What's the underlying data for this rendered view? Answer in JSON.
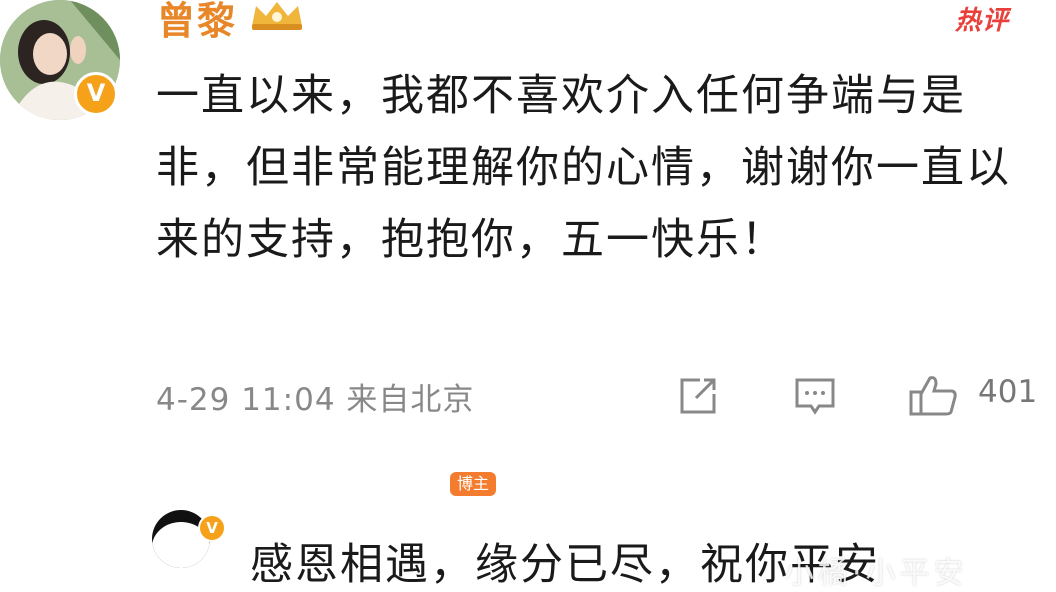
{
  "comment": {
    "username": "曾黎",
    "verified_mark": "V",
    "hot_label": "热评",
    "text": "一直以来，我都不喜欢介入任何争端与是非，但非常能理解你的心情，谢谢你一直以来的支持，抱抱你，五一快乐！",
    "timestamp": "4-29 11:04",
    "location": "来自北京",
    "like_count": "401",
    "icons": {
      "share": "share-icon",
      "comment": "comment-icon",
      "like": "thumbs-up-icon",
      "badge": "crown-badge-icon"
    }
  },
  "reply": {
    "blogger_label": "博主",
    "verified_mark": "V",
    "text": "感恩相遇，缘分已尽，祝你平安"
  },
  "watermark": {
    "text": "小橘·小平安"
  },
  "colors": {
    "username": "#e8872a",
    "hot": "#e8413c",
    "verified": "#f6a11a",
    "meta": "#888888",
    "blogger_tag": "#f47c2f"
  }
}
